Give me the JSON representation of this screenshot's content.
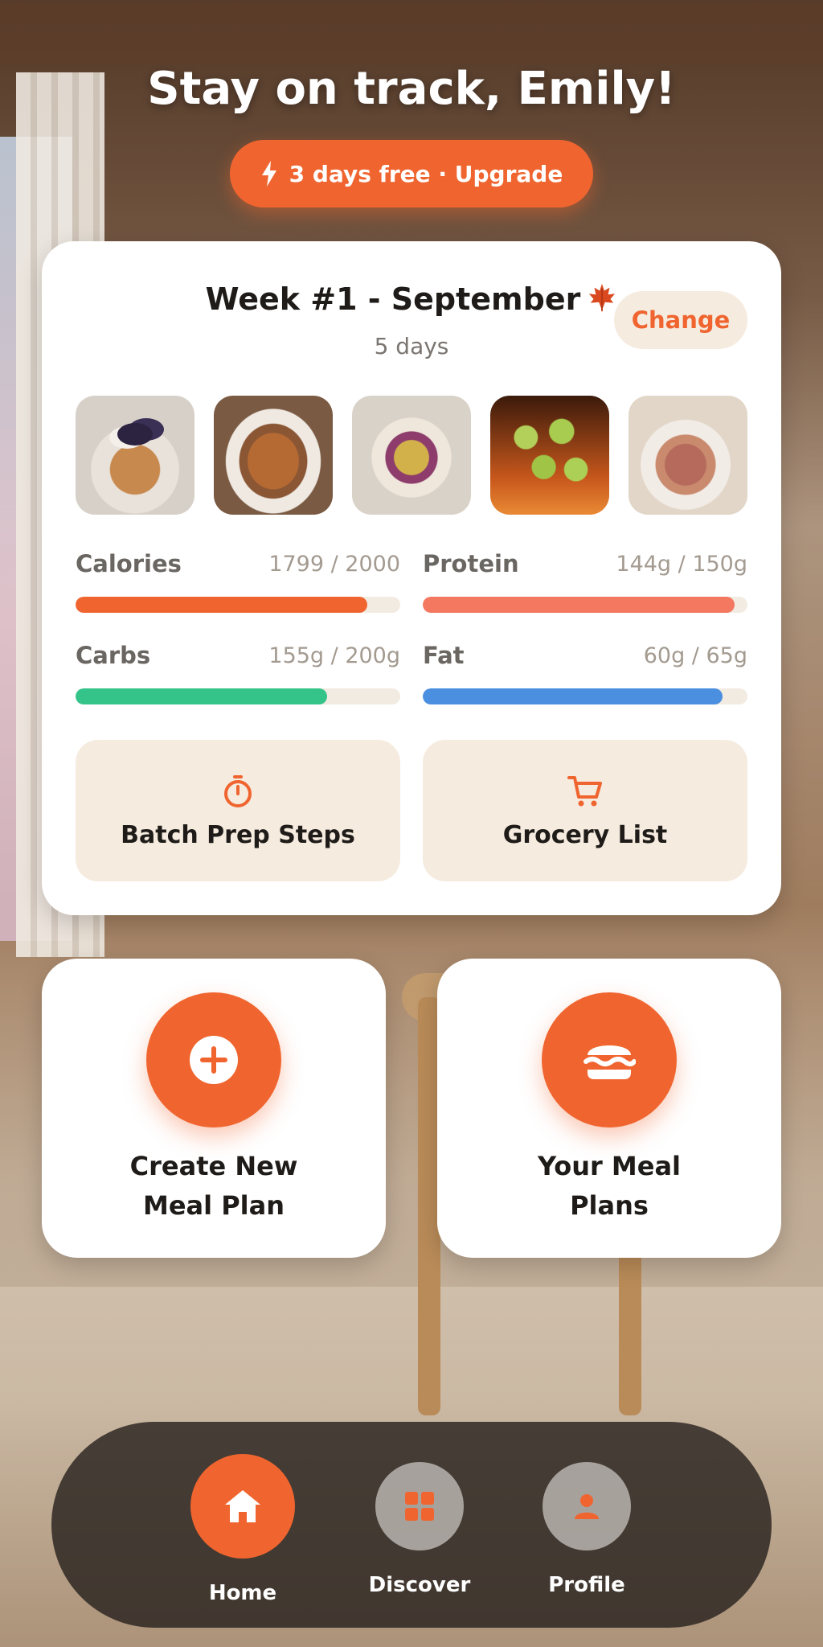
{
  "header": {
    "greeting": "Stay on track, Emily!",
    "upgrade_label": "3 days free · Upgrade"
  },
  "plan": {
    "title": "Week #1 - September",
    "title_emoji_icon": "maple-leaf-icon",
    "subtitle": "5 days",
    "change_label": "Change",
    "meals": [
      {
        "name": "pancakes-with-berries"
      },
      {
        "name": "loaded-baked-potato"
      },
      {
        "name": "grain-bowl"
      },
      {
        "name": "green-grapes"
      },
      {
        "name": "raspberry-bars"
      }
    ],
    "macros": [
      {
        "label": "Calories",
        "value": "1799 / 2000",
        "fraction": 0.8995,
        "color": "#f0652f"
      },
      {
        "label": "Protein",
        "value": "144g / 150g",
        "fraction": 0.96,
        "color": "#f47760"
      },
      {
        "label": "Carbs",
        "value": "155g / 200g",
        "fraction": 0.775,
        "color": "#34c48a"
      },
      {
        "label": "Fat",
        "value": "60g / 65g",
        "fraction": 0.923,
        "color": "#4a8fe0"
      }
    ],
    "actions": {
      "batch_prep": "Batch Prep Steps",
      "grocery": "Grocery List"
    }
  },
  "tiles": {
    "create": "Create New\nMeal Plan",
    "your_plans": "Your Meal\nPlans"
  },
  "nav": {
    "home": "Home",
    "discover": "Discover",
    "profile": "Profile",
    "active": "home"
  },
  "colors": {
    "accent": "#f0652f",
    "card_bg": "#ffffff",
    "soft_bg": "#f5ebdf"
  }
}
